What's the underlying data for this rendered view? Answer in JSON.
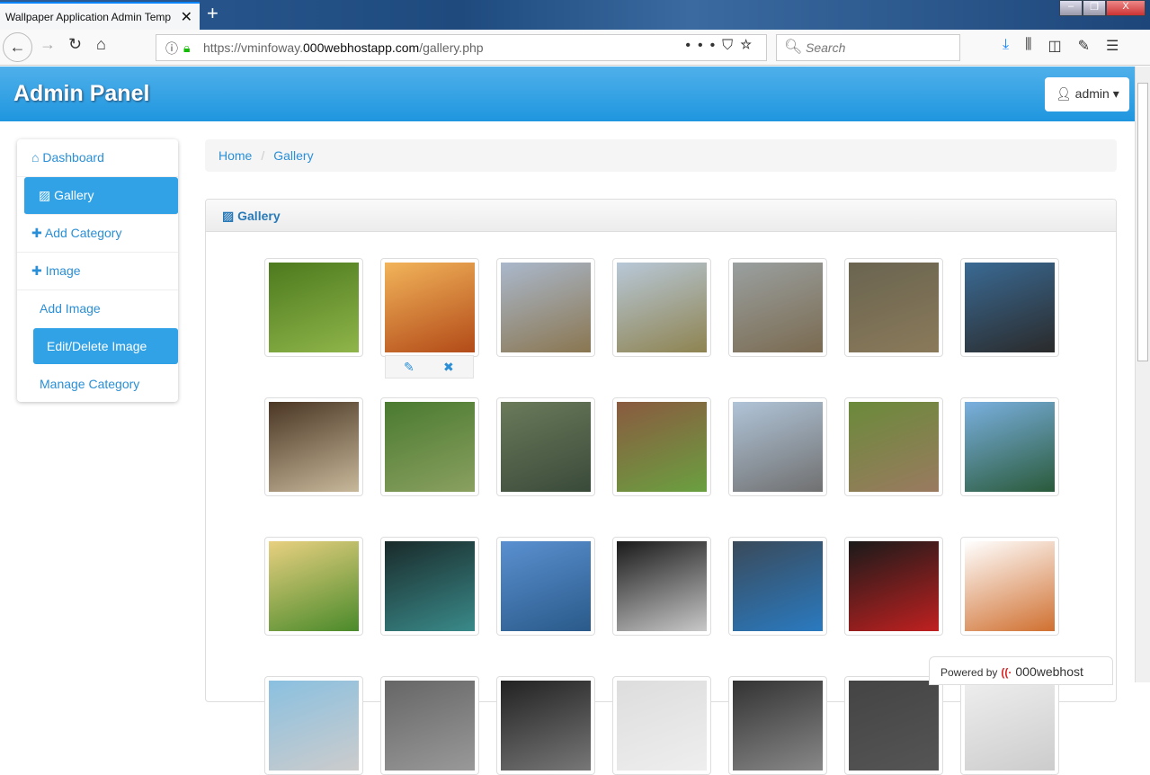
{
  "browser": {
    "tab_title": "Wallpaper Application Admin Temp",
    "url_prefix": "https://vminfoway.",
    "url_domain": "000webhostapp.com",
    "url_path": "/gallery.php",
    "search_placeholder": "Search"
  },
  "header": {
    "brand": "Admin Panel",
    "user": "admin"
  },
  "sidebar": {
    "items": [
      {
        "label": "Dashboard",
        "icon": "home-icon"
      },
      {
        "label": "Gallery",
        "icon": "picture-icon"
      },
      {
        "label": "Add Category",
        "icon": "plus-icon"
      },
      {
        "label": "Image",
        "icon": "plus-icon"
      }
    ],
    "sub": [
      "Add Image",
      "Edit/Delete Image",
      "Manage Category"
    ]
  },
  "breadcrumb": [
    "Home",
    "Gallery"
  ],
  "panel": {
    "title": "Gallery"
  },
  "gallery": [
    [
      "#4d7a1e",
      "#8fb54a"
    ],
    [
      "#f2b45a",
      "#b24a18"
    ],
    [
      "#aab8cc",
      "#8a7650"
    ],
    [
      "#b8c8d8",
      "#8e8350"
    ],
    [
      "#9aa0a0",
      "#7a6a50"
    ],
    [
      "#6a6450",
      "#8a7a5a"
    ],
    [
      "#3a6a94",
      "#2a2a2a"
    ],
    [
      "#4a3624",
      "#c8b89a"
    ],
    [
      "#4a7a30",
      "#8aa060"
    ],
    [
      "#6a7a5a",
      "#3a4a3a"
    ],
    [
      "#8a5a40",
      "#6aa040"
    ],
    [
      "#b0c4d8",
      "#707070"
    ],
    [
      "#6a8a3a",
      "#9a7a60"
    ],
    [
      "#7ab0e0",
      "#2a5a3a"
    ],
    [
      "#e8d080",
      "#4a8a2a"
    ],
    [
      "#1a2a2a",
      "#3a8a8a"
    ],
    [
      "#5a90d0",
      "#2a5a8a"
    ],
    [
      "#1a1a1a",
      "#c8c8c8"
    ],
    [
      "#3a4a5a",
      "#2a7ac0"
    ],
    [
      "#1a1a1a",
      "#c02020"
    ],
    [
      "#ffffff",
      "#d07030"
    ],
    [
      "#8ac0e0",
      "#cccccc"
    ],
    [
      "#666666",
      "#999999"
    ],
    [
      "#222222",
      "#777777"
    ],
    [
      "#dddddd",
      "#eeeeee"
    ],
    [
      "#333333",
      "#888888"
    ],
    [
      "#444444",
      "#555555"
    ],
    [
      "#eeeeee",
      "#cccccc"
    ]
  ],
  "powered": {
    "text": "Powered by",
    "brand": "000webhost"
  }
}
